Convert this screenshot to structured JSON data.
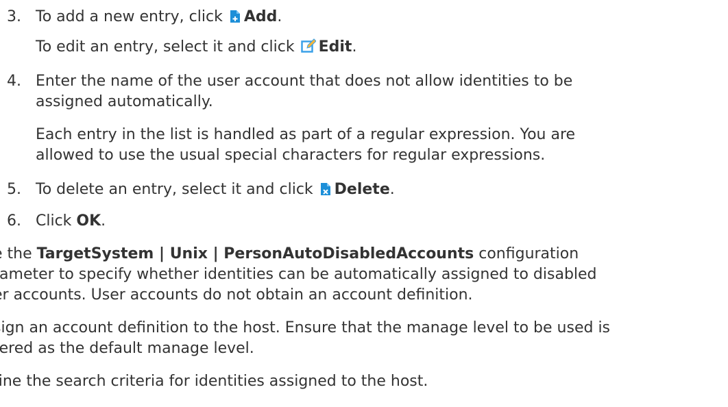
{
  "steps": [
    {
      "number": "3.",
      "pre": "To add a new entry, click ",
      "icon": "add-icon",
      "bold": "Add",
      "post": "."
    },
    {
      "pre": "To edit an entry, select it and click ",
      "icon": "edit-icon",
      "bold": "Edit",
      "post": "."
    },
    {
      "number": "4.",
      "line1": "Enter the name of the user account that does not allow identities to be",
      "line2": "assigned automatically."
    },
    {
      "line1": "Each entry in the list is handled as part of a regular expression. You are",
      "line2": "allowed to use the usual special characters for regular expressions."
    },
    {
      "number": "5.",
      "pre": "To delete an entry, select it and click ",
      "icon": "delete-icon",
      "bold": "Delete",
      "post": "."
    },
    {
      "number": "6.",
      "pre": "Click ",
      "bold": "OK",
      "post": "."
    }
  ],
  "paragraphs": [
    {
      "pre": "e the ",
      "bold": "TargetSystem | Unix | PersonAutoDisabledAccounts",
      "post": " configuration",
      "line2": "rameter to specify whether identities can be automatically assigned to disabled",
      "line3": "er accounts. User accounts do not obtain an account definition."
    },
    {
      "line1": "sign an account definition to the host. Ensure that the manage level to be used is",
      "line2": "tered as the default manage level."
    },
    {
      "line1": "fine the search criteria for identities assigned to the host."
    }
  ],
  "colors": {
    "text": "#333333",
    "icon_blue": "#1d8fd8",
    "icon_edit": "#3aa0e8"
  }
}
